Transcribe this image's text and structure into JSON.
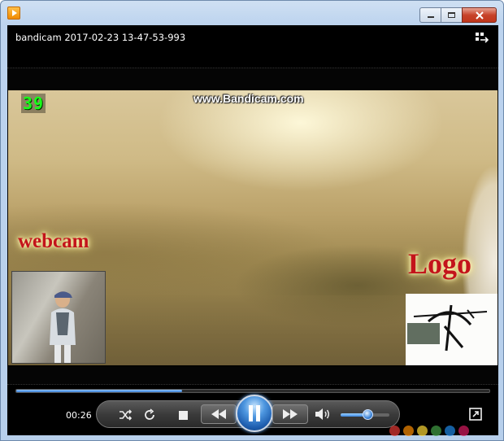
{
  "window": {
    "caption_buttons": {
      "minimize": "minimize",
      "maximize": "maximize",
      "close": "close"
    }
  },
  "player": {
    "file_title": "bandicam 2017-02-23 13-47-53-993",
    "overlay": {
      "fps_counter": "39",
      "watermark": "www.Bandicam.com",
      "webcam_label": "webcam",
      "logo_label": "Logo"
    },
    "controls": {
      "current_time": "00:26",
      "seek_progress": 0.35,
      "volume_level": 0.55
    },
    "colors": {
      "accent": "#3a7fd6",
      "fps_green": "#18ff18",
      "label_red": "#c3141b"
    }
  }
}
